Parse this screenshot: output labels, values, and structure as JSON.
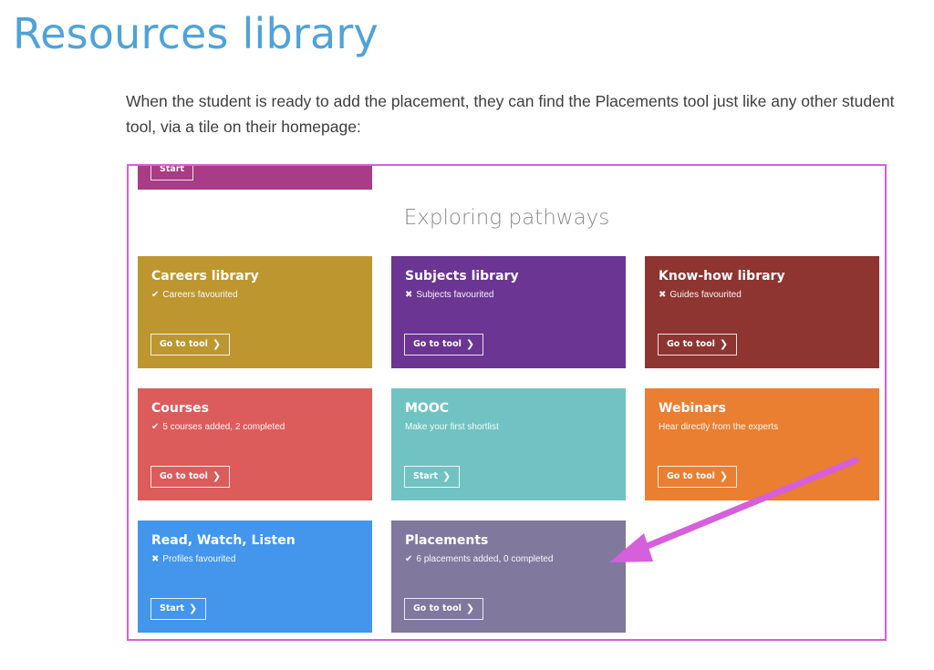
{
  "page": {
    "title": "Resources library",
    "intro": "When the student is ready to add the placement, they can find the Placements tool just like any other student tool, via a tile on their homepage:"
  },
  "screenshot": {
    "partial_tile_button": "Start",
    "section_heading": "Exploring pathways",
    "tiles": [
      {
        "title": "Careers library",
        "status_icon": "check-icon",
        "status_glyph": "✔",
        "status": "Careers favourited",
        "button": "Go to tool",
        "color": "#bd962f"
      },
      {
        "title": "Subjects library",
        "status_icon": "cross-icon",
        "status_glyph": "✖",
        "status": "Subjects favourited",
        "button": "Go to tool",
        "color": "#6b3593"
      },
      {
        "title": "Know-how library",
        "status_icon": "cross-icon",
        "status_glyph": "✖",
        "status": "Guides favourited",
        "button": "Go to tool",
        "color": "#8e3431"
      },
      {
        "title": "Courses",
        "status_icon": "check-icon",
        "status_glyph": "✔",
        "status": "5 courses added, 2 completed",
        "button": "Go to tool",
        "color": "#dc5b5b"
      },
      {
        "title": "MOOC",
        "status_icon": "",
        "status_glyph": "",
        "status": "Make your first shortlist",
        "button": "Start",
        "color": "#70c3c2"
      },
      {
        "title": "Webinars",
        "status_icon": "",
        "status_glyph": "",
        "status": "Hear directly from the experts",
        "button": "Go to tool",
        "color": "#ea7e31"
      },
      {
        "title": "Read, Watch, Listen",
        "status_icon": "cross-icon",
        "status_glyph": "✖",
        "status": "Profiles favourited",
        "button": "Start",
        "color": "#4396ec"
      },
      {
        "title": "Placements",
        "status_icon": "check-icon",
        "status_glyph": "✔",
        "status": "6 placements added, 0 completed",
        "button": "Go to tool",
        "color": "#80789d"
      }
    ],
    "chevron_icon": "chevron-right-icon",
    "chevron_glyph": "❯",
    "annotation_arrow_color": "#d65fdb",
    "frame_color": "#d65fdb"
  }
}
